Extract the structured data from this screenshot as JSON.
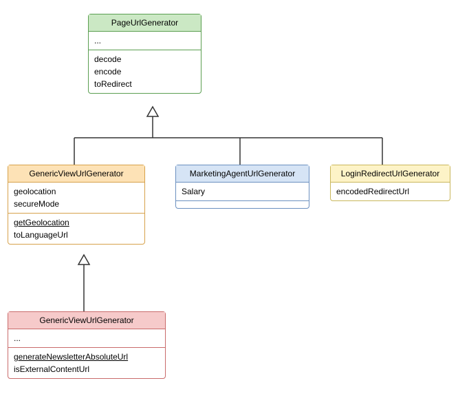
{
  "classes": {
    "pageUrlGenerator": {
      "name": "PageUrlGenerator",
      "attrsEllipsis": "...",
      "methods": [
        "decode",
        "encode",
        "toRedirect"
      ]
    },
    "genericViewUrlGenerator": {
      "name": "GenericViewUrlGenerator",
      "attrs": [
        "geolocation",
        "secureMode"
      ],
      "methods": [
        "getGeolocation",
        "toLanguageUrl"
      ],
      "staticMethods": [
        "getGeolocation"
      ]
    },
    "marketingAgentUrlGenerator": {
      "name": "MarketingAgentUrlGenerator",
      "attrs": [
        "Salary"
      ]
    },
    "loginRedirectUrlGenerator": {
      "name": "LoginRedirectUrlGenerator",
      "attrs": [
        "encodedRedirectUrl"
      ]
    },
    "genericViewUrlGenerator2": {
      "name": "GenericViewUrlGenerator",
      "attrsEllipsis": "...",
      "methods": [
        "generateNewsletterAbsoluteUrl",
        "isExternalContentUrl"
      ],
      "staticMethods": [
        "generateNewsletterAbsoluteUrl"
      ]
    }
  },
  "relationships": [
    {
      "from": "genericViewUrlGenerator",
      "to": "pageUrlGenerator",
      "type": "inheritance"
    },
    {
      "from": "marketingAgentUrlGenerator",
      "to": "pageUrlGenerator",
      "type": "inheritance"
    },
    {
      "from": "loginRedirectUrlGenerator",
      "to": "pageUrlGenerator",
      "type": "inheritance"
    },
    {
      "from": "genericViewUrlGenerator2",
      "to": "genericViewUrlGenerator",
      "type": "inheritance"
    }
  ]
}
